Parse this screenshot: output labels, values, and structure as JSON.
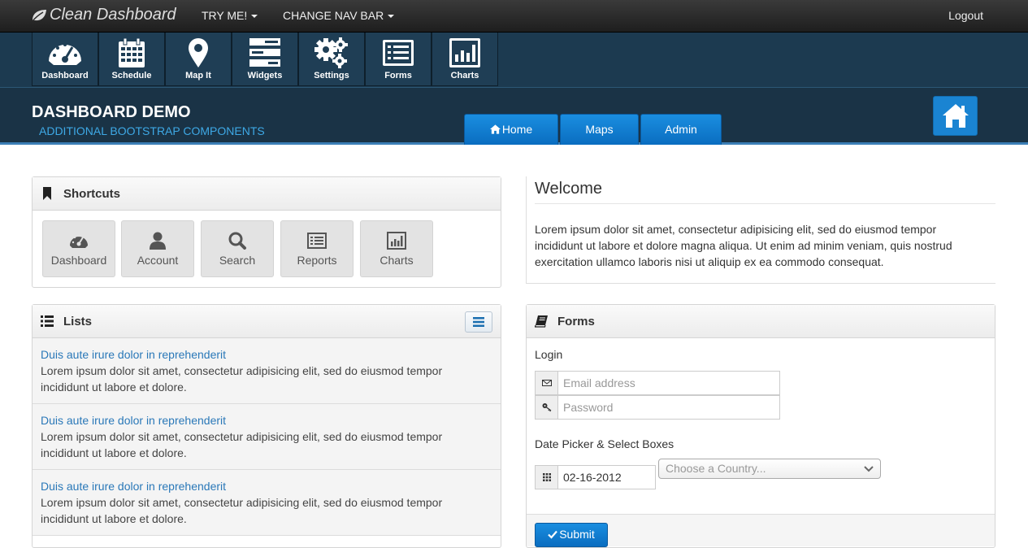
{
  "topbar": {
    "brand": "Clean Dashboard",
    "nav": [
      "TRY ME!",
      "CHANGE NAV BAR"
    ],
    "logout": "Logout"
  },
  "toolbar": {
    "items": [
      {
        "label": "Dashboard",
        "icon": "gauge-icon"
      },
      {
        "label": "Schedule",
        "icon": "calendar-icon"
      },
      {
        "label": "Map It",
        "icon": "map-marker-icon"
      },
      {
        "label": "Widgets",
        "icon": "widgets-icon"
      },
      {
        "label": "Settings",
        "icon": "gears-icon"
      },
      {
        "label": "Forms",
        "icon": "list-alt-icon"
      },
      {
        "label": "Charts",
        "icon": "bar-chart-icon"
      }
    ]
  },
  "header": {
    "title": "DASHBOARD DEMO",
    "subtitle": "ADDITIONAL BOOTSTRAP COMPONENTS",
    "tabs": [
      "Home",
      "Maps",
      "Admin"
    ]
  },
  "shortcuts": {
    "title": "Shortcuts",
    "items": [
      {
        "label": "Dashboard",
        "icon": "gauge-icon"
      },
      {
        "label": "Account",
        "icon": "user-icon"
      },
      {
        "label": "Search",
        "icon": "search-icon"
      },
      {
        "label": "Reports",
        "icon": "list-alt-icon"
      },
      {
        "label": "Charts",
        "icon": "bar-chart-icon"
      }
    ]
  },
  "lists": {
    "title": "Lists",
    "items": [
      {
        "link": "Duis aute irure dolor in reprehenderit",
        "text": "Lorem ipsum dolor sit amet, consectetur adipisicing elit, sed do eiusmod tempor incididunt ut labore et dolore."
      },
      {
        "link": "Duis aute irure dolor in reprehenderit",
        "text": "Lorem ipsum dolor sit amet, consectetur adipisicing elit, sed do eiusmod tempor incididunt ut labore et dolore."
      },
      {
        "link": "Duis aute irure dolor in reprehenderit",
        "text": "Lorem ipsum dolor sit amet, consectetur adipisicing elit, sed do eiusmod tempor incididunt ut labore et dolore."
      }
    ]
  },
  "welcome": {
    "title": "Welcome",
    "body": "Lorem ipsum dolor sit amet, consectetur adipisicing elit, sed do eiusmod tempor incididunt ut labore et dolore magna aliqua. Ut enim ad minim veniam, quis nostrud exercitation ullamco laboris nisi ut aliquip ex ea commodo consequat."
  },
  "forms": {
    "title": "Forms",
    "login_label": "Login",
    "email_placeholder": "Email address",
    "password_placeholder": "Password",
    "date_label": "Date Picker & Select Boxes",
    "date_value": "02-16-2012",
    "country_placeholder": "Choose a Country...",
    "submit": "Submit"
  },
  "colors": {
    "accent": "#0a6dc0",
    "link": "#2a78b8",
    "subtitle": "#3ea9e6"
  }
}
